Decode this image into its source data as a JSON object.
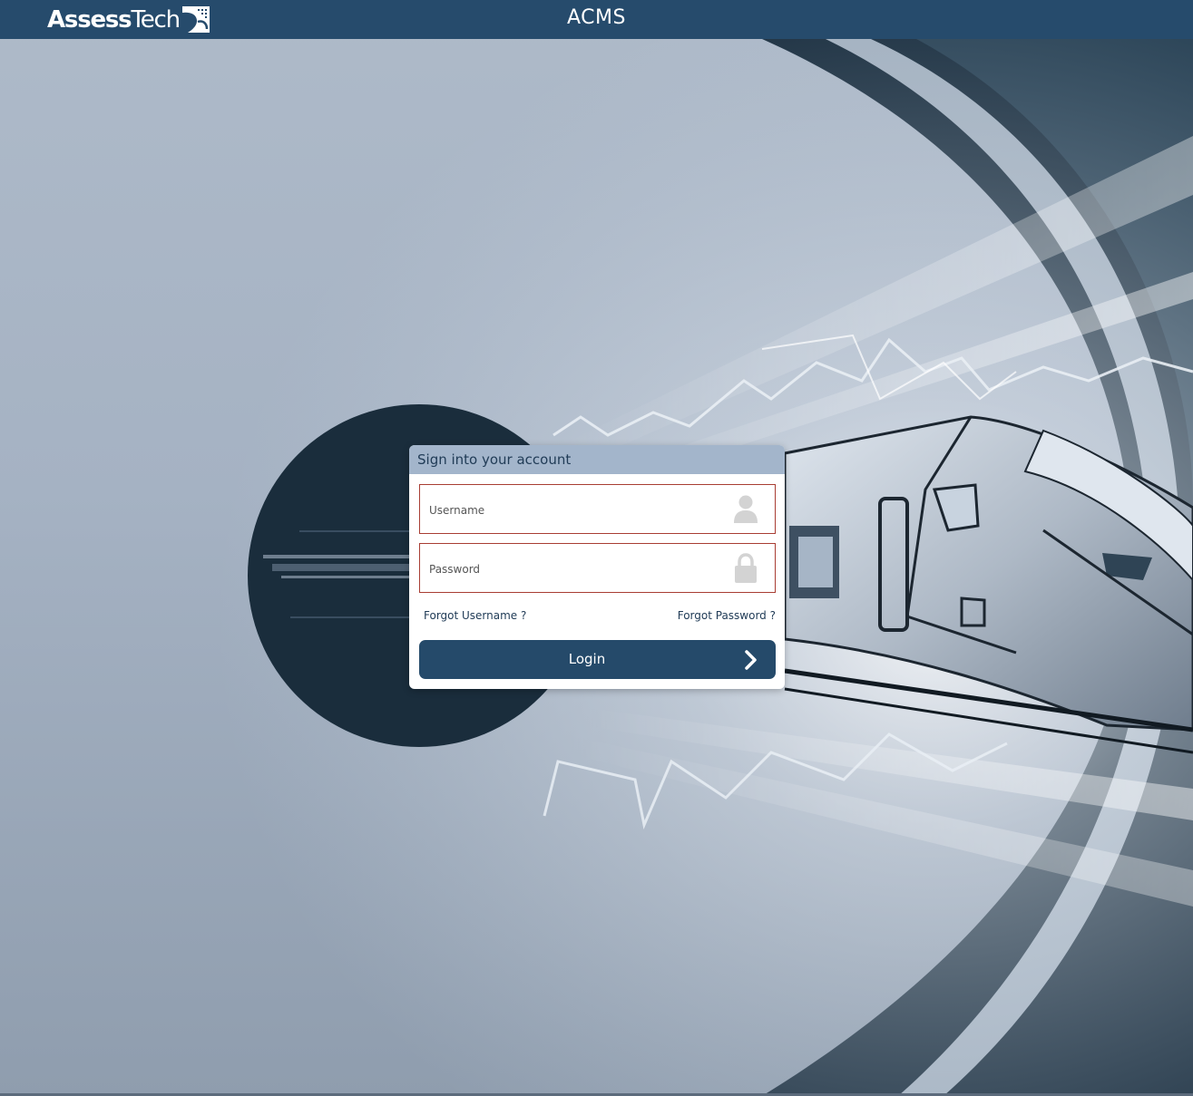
{
  "header": {
    "logo_bold": "Assess",
    "logo_light": "Tech",
    "title": "ACMS"
  },
  "login": {
    "heading": "Sign into your account",
    "username_placeholder": "Username",
    "password_placeholder": "Password",
    "forgot_username": "Forgot Username ?",
    "forgot_password": "Forgot Password ?",
    "login_label": "Login"
  },
  "icons": {
    "logo": "assesstech-logo-mark",
    "username": "user-icon",
    "password": "lock-icon",
    "login": "chevron-right-icon"
  },
  "colors": {
    "header_bg": "#264b6c",
    "panel_header_bg": "#a3b5cb",
    "field_border": "#a83d33",
    "button_bg": "#254a6a",
    "background": "#aebac9"
  }
}
